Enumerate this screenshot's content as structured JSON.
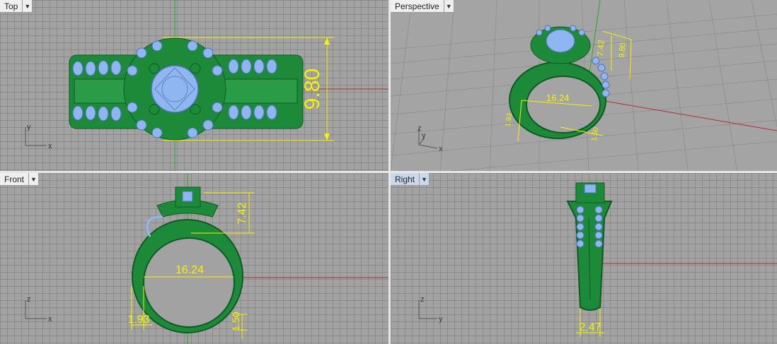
{
  "viewports": {
    "top": {
      "label": "Top",
      "dims": {
        "height": "9.80"
      }
    },
    "perspective": {
      "label": "Perspective",
      "dims": {
        "width": "16.24",
        "height_a": "7.42",
        "height_b": "9.80",
        "band": "1.93",
        "thick": "1.50"
      }
    },
    "front": {
      "label": "Front",
      "dims": {
        "width": "16.24",
        "height": "7.42",
        "band": "1.93",
        "thick": "1.50"
      }
    },
    "right": {
      "label": "Right",
      "dims": {
        "width": "2.47"
      }
    }
  },
  "axes": {
    "top": {
      "a": "y",
      "b": "x"
    },
    "perspective": {
      "a": "z",
      "b": "y",
      "c": "x"
    },
    "front": {
      "a": "z",
      "b": "x"
    },
    "right": {
      "a": "z",
      "b": "y"
    }
  },
  "colors": {
    "viewport_bg": "#a2a2a2",
    "ring_green": "#1d8a3a",
    "gem_blue": "#8fb6f0",
    "dimension_yellow": "#f4f400",
    "x_axis": "#b03030",
    "y_axis": "#2aa62a"
  },
  "icons": {
    "viewport_menu": "caret-down-icon"
  }
}
